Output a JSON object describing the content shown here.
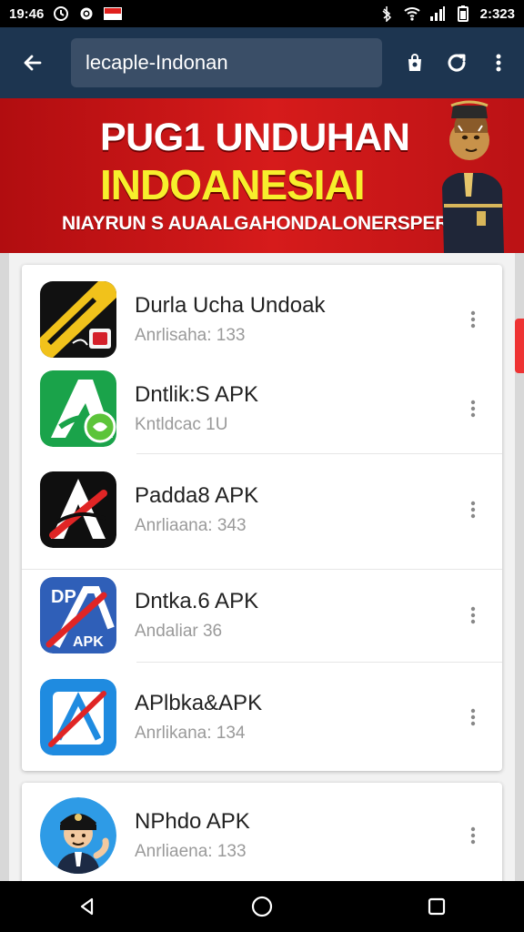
{
  "status_bar": {
    "time_left": "19:46",
    "time_right": "2:323"
  },
  "header": {
    "search_query": "lecaple-Indonan"
  },
  "banner": {
    "title": "PUG1 UNDUHAN",
    "subtitle": "INDOANESIAI",
    "tagline": "NIAYRUN S AUAALGAHONDALONERSPERSIS"
  },
  "list": [
    {
      "title": "Durla Ucha Undoak",
      "subtitle": "Anrlisaha: 133",
      "icon": "app-icon-1"
    },
    {
      "title": "Dntlik:S APK",
      "subtitle": "Kntldcac 1U",
      "icon": "app-icon-2"
    },
    {
      "title": "Padda8 APK",
      "subtitle": "Anrliaana: 343",
      "icon": "app-icon-3"
    },
    {
      "title": "Dntka.6 APK",
      "subtitle": "Andaliar 36",
      "icon": "app-icon-4"
    },
    {
      "title": "APlbka&APK",
      "subtitle": "Anrlikana: 134",
      "icon": "app-icon-5"
    },
    {
      "title": "NPhdo APK",
      "subtitle": "Anrliaena: 133",
      "icon": "app-icon-6"
    }
  ],
  "app_icons": {
    "icon_1_label": "",
    "icon_4_label": "DP",
    "icon_4_sub": "APK"
  },
  "colors": {
    "appbar": "#1d3550",
    "banner_red": "#d61b1b",
    "banner_yellow": "#f7ef2c"
  }
}
